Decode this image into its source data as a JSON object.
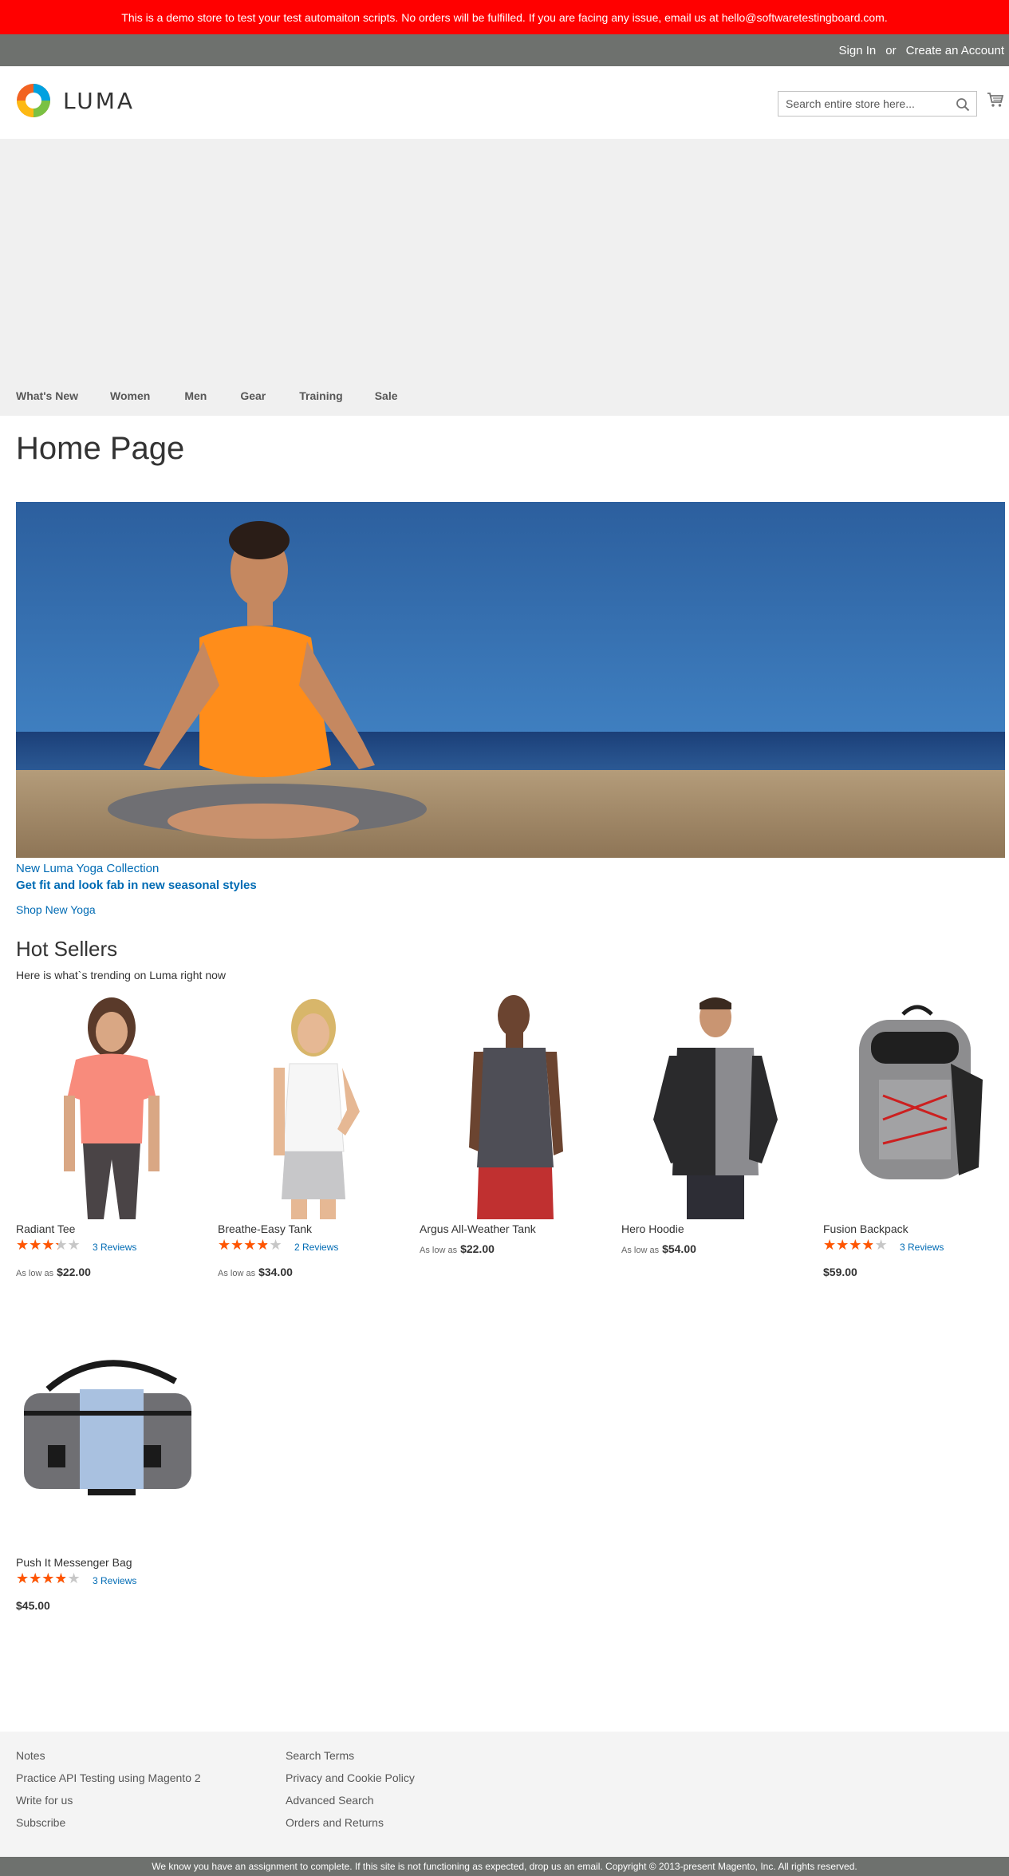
{
  "demo_notice": "This is a demo store to test your test automaiton scripts. No orders will be fulfilled. If you are facing any issue, email us at hello@softwaretestingboard.com.",
  "header_links": {
    "sign_in": "Sign In",
    "or": "or",
    "create_account": "Create an Account"
  },
  "logo": {
    "text": "LUMA"
  },
  "search": {
    "placeholder": "Search entire store here..."
  },
  "nav": [
    "What's New",
    "Women",
    "Men",
    "Gear",
    "Training",
    "Sale"
  ],
  "page_title": "Home Page",
  "hero": {
    "link1": "New Luma Yoga Collection",
    "link2": "Get fit and look fab in new seasonal styles",
    "link3": "Shop New Yoga"
  },
  "hot_sellers": {
    "title": "Hot Sellers",
    "subtitle": "Here is what`s trending on Luma right now",
    "products": [
      {
        "name": "Radiant Tee",
        "rating_percent": 60,
        "reviews": "3 Reviews",
        "price_label": "As low as",
        "price": "$22.00"
      },
      {
        "name": "Breathe-Easy Tank",
        "rating_percent": 70,
        "reviews": "2 Reviews",
        "price_label": "As low as",
        "price": "$34.00"
      },
      {
        "name": "Argus All-Weather Tank",
        "rating_percent": null,
        "reviews": "",
        "price_label": "As low as",
        "price": "$22.00"
      },
      {
        "name": "Hero Hoodie",
        "rating_percent": null,
        "reviews": "",
        "price_label": "As low as",
        "price": "$54.00"
      },
      {
        "name": "Fusion Backpack",
        "rating_percent": 70,
        "reviews": "3 Reviews",
        "price_label": "",
        "price": "$59.00"
      },
      {
        "name": "Push It Messenger Bag",
        "rating_percent": 70,
        "reviews": "3 Reviews",
        "price_label": "",
        "price": "$45.00"
      }
    ]
  },
  "footer": {
    "col1": [
      "Notes",
      "Practice API Testing using Magento 2",
      "Write for us",
      "Subscribe"
    ],
    "col2": [
      "Search Terms",
      "Privacy and Cookie Policy",
      "Advanced Search",
      "Orders and Returns"
    ]
  },
  "copyright": "We know you have an assignment to complete. If this site is not functioning as expected, drop us an email. Copyright © 2013-present Magento, Inc. All rights reserved.",
  "colors": {
    "notice": "#ff0000",
    "panel": "#6e716e",
    "link": "#006bb4",
    "star": "#ff5501"
  }
}
